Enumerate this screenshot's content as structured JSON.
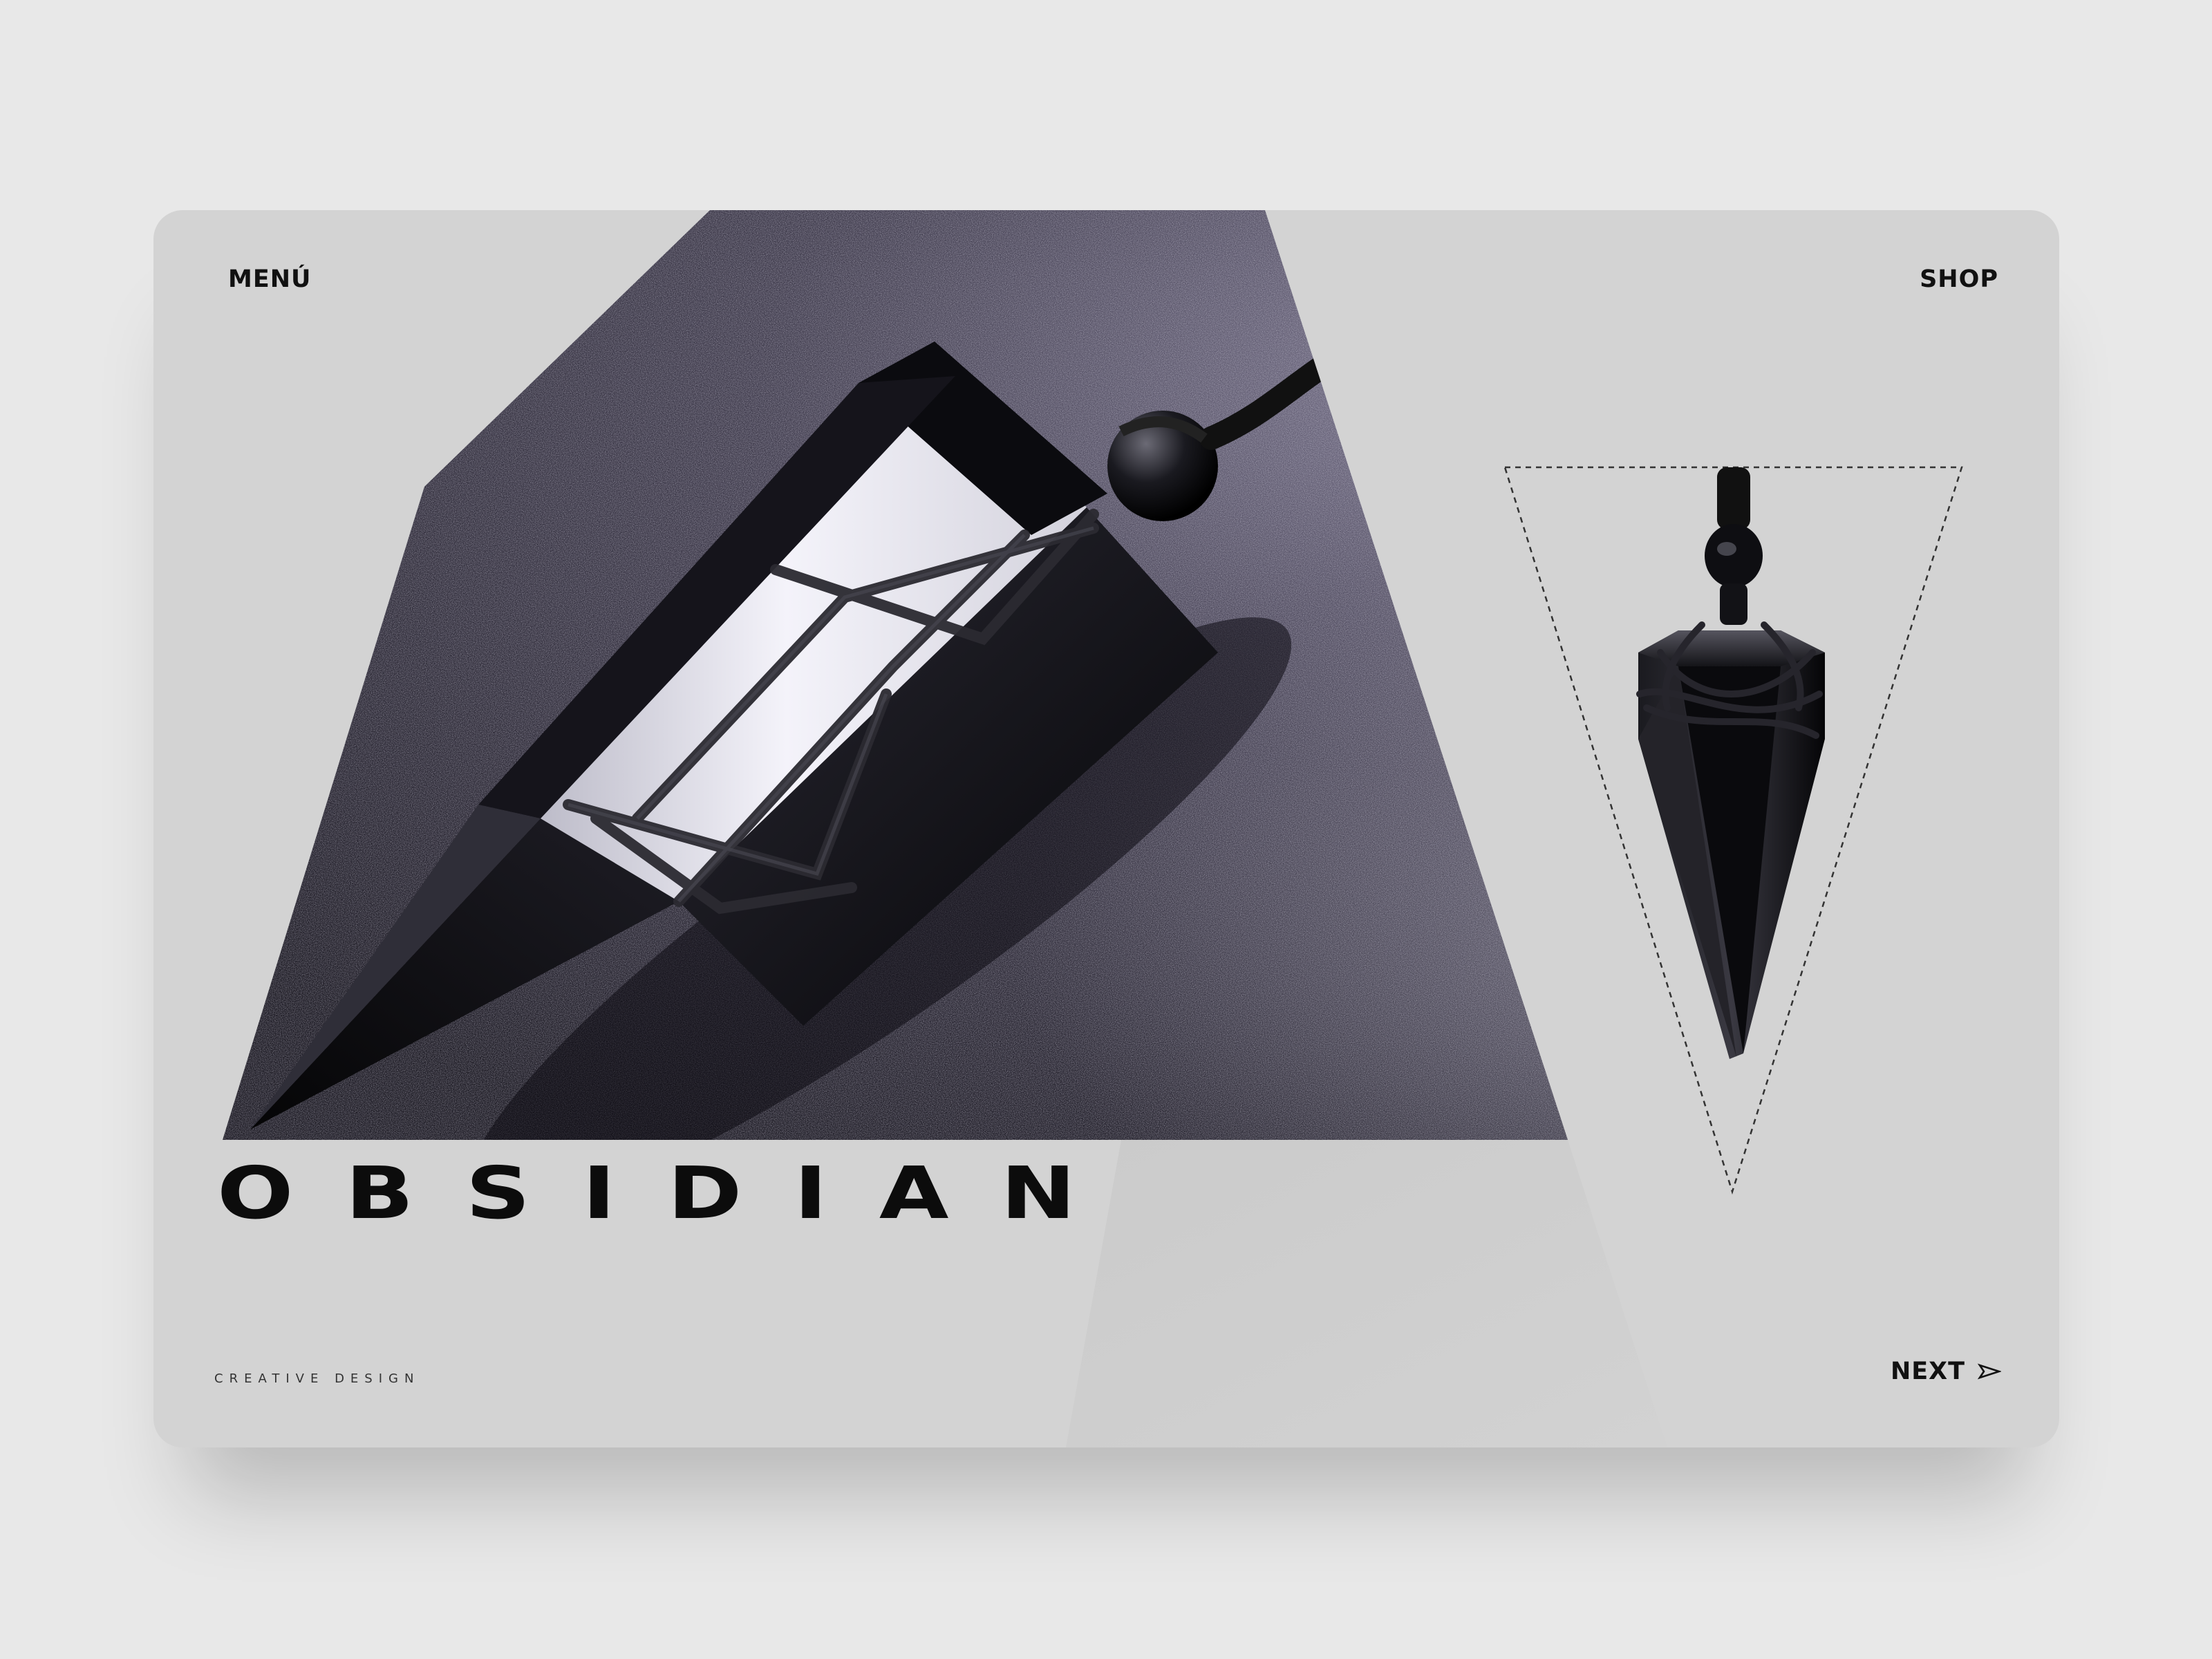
{
  "nav": {
    "menu_label": "MENÚ",
    "shop_label": "SHOP"
  },
  "hero": {
    "title": "OBSIDIAN",
    "tagline": "CREATIVE DESIGN"
  },
  "footer": {
    "next_label": "NEXT",
    "next_icon": "arrow-right-outline-icon"
  },
  "colors": {
    "card_background": "#d3d3d3",
    "page_background": "#e8e8e8",
    "text": "#111111"
  }
}
